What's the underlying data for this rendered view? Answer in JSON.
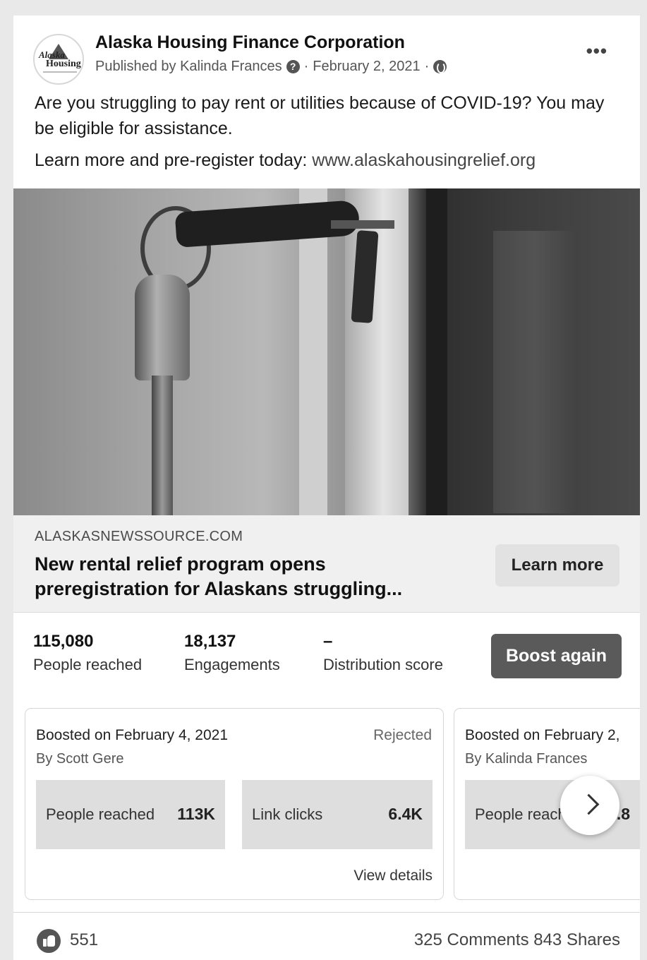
{
  "post": {
    "page_name": "Alaska Housing Finance Corporation",
    "avatar": {
      "line1": "Alaska",
      "line2": "Housing",
      "icon": "ahfc-logo"
    },
    "published_by": "Published by Kalinda Frances",
    "separator_1": "·",
    "date": "February 2, 2021",
    "separator_2": "·",
    "more_icon": "more-dots-icon",
    "text_line": "Are you struggling to pay rent or utilities because of COVID-19? You may be eligible for assistance.",
    "cta_text": "Learn more and pre-register today: ",
    "cta_link": "www.alaskahousingrelief.org"
  },
  "link_preview": {
    "domain": "ALASKASNEWSSOURCE.COM",
    "title": "New rental relief program opens preregistration for Alaskans struggling...",
    "button": "Learn more"
  },
  "stats": {
    "people_reached_value": "115,080",
    "people_reached_label": "People reached",
    "engagements_value": "18,137",
    "engagements_label": "Engagements",
    "distribution_value": "–",
    "distribution_label": "Distribution score",
    "boost_button": "Boost again"
  },
  "boosts": [
    {
      "title": "Boosted on February 4, 2021",
      "status": "Rejected",
      "by": "By Scott Gere",
      "metric1_label": "People reached",
      "metric1_value": "113K",
      "metric2_label": "Link clicks",
      "metric2_value": "6.4K",
      "details": "View details"
    },
    {
      "title": "Boosted on February 2,",
      "by": "By Kalinda Frances",
      "metric1_label": "People reach",
      "metric1_value": ".8"
    }
  ],
  "footer": {
    "likes": "551",
    "comments_shares": "325 Comments  843 Shares"
  },
  "colors": {
    "boost_button_bg": "#5a5a5a",
    "preview_bg": "#f0f0f0",
    "metric_bg": "#dedede"
  }
}
